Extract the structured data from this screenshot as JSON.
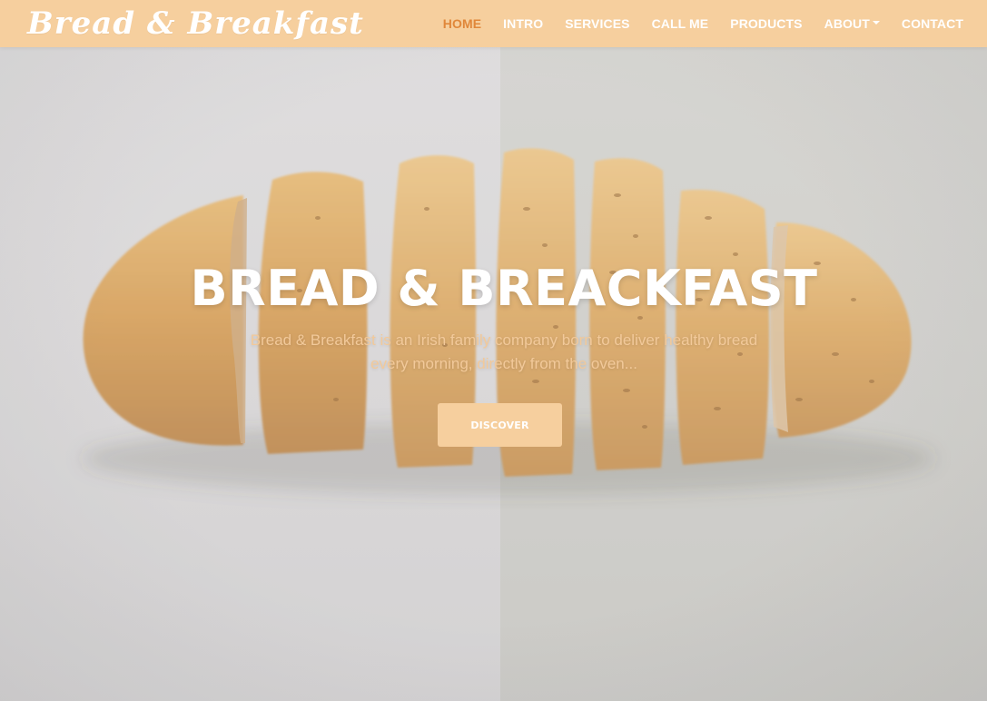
{
  "brand": {
    "name": "Bread & Breakfast"
  },
  "nav": {
    "items": [
      {
        "label": "HOME",
        "active": true
      },
      {
        "label": "INTRO"
      },
      {
        "label": "SERVICES"
      },
      {
        "label": "CALL ME"
      },
      {
        "label": "PRODUCTS"
      },
      {
        "label": "ABOUT",
        "dropdown": true
      },
      {
        "label": "CONTACT"
      }
    ]
  },
  "hero": {
    "title": "BREAD & BREACKFAST",
    "subtitle": "Bread & Breakfast is an Irish family company born to deliver healthy bread every morning, directly from the oven...",
    "button_label": "DISCOVER",
    "image_icon": "sliced-bread-loaf"
  },
  "colors": {
    "navbar_bg": "#f6cf9e",
    "accent": "#e0873a",
    "button_bg": "#f6cf9e",
    "subtitle": "#f2c99a"
  }
}
